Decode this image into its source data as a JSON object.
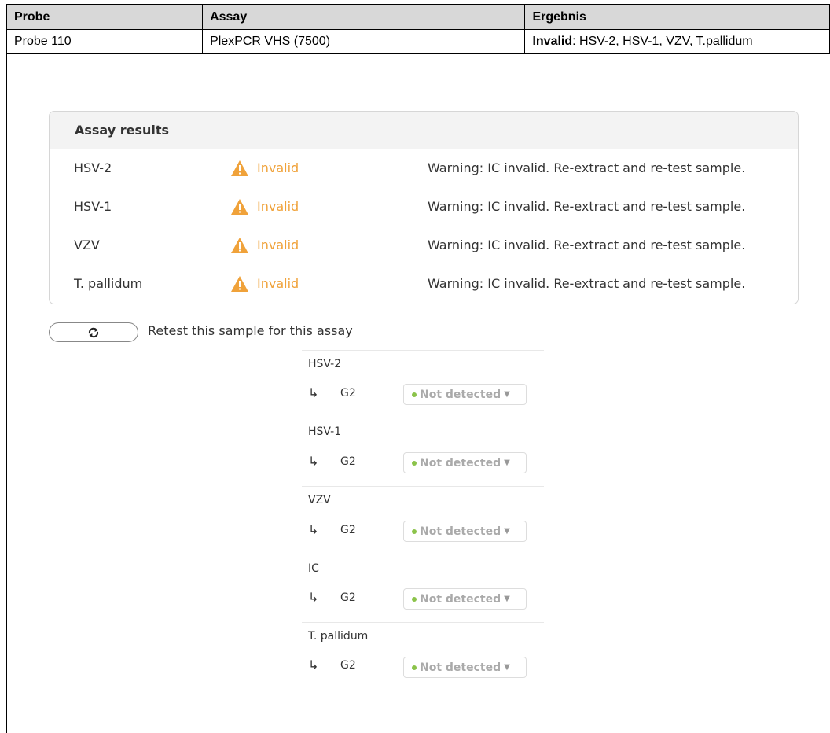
{
  "table": {
    "headers": [
      "Probe",
      "Assay",
      "Ergebnis"
    ],
    "row": {
      "probe": "Probe 110",
      "assay": "PlexPCR VHS (7500)",
      "result_bold": "Invalid",
      "result_rest": ": HSV-2, HSV-1, VZV, T.pallidum"
    }
  },
  "card": {
    "title": "Assay results",
    "rows": [
      {
        "name": "HSV-2",
        "status": "Invalid",
        "message": "Warning: IC invalid. Re-extract and re-test sample."
      },
      {
        "name": "HSV-1",
        "status": "Invalid",
        "message": "Warning: IC invalid. Re-extract and re-test sample."
      },
      {
        "name": "VZV",
        "status": "Invalid",
        "message": "Warning: IC invalid. Re-extract and re-test sample."
      },
      {
        "name": "T. pallidum",
        "status": "Invalid",
        "message": "Warning: IC invalid. Re-extract and re-test sample."
      }
    ]
  },
  "retest": {
    "label": "Retest this sample for this assay",
    "icon": "refresh-icon"
  },
  "overrides": [
    {
      "target": "HSV-2",
      "arrow": "↳",
      "channel": "G2",
      "value": "Not detected"
    },
    {
      "target": "HSV-1",
      "arrow": "↳",
      "channel": "G2",
      "value": "Not detected"
    },
    {
      "target": "VZV",
      "arrow": "↳",
      "channel": "G2",
      "value": "Not detected"
    },
    {
      "target": "IC",
      "arrow": "↳",
      "channel": "G2",
      "value": "Not detected"
    },
    {
      "target": "T. pallidum",
      "arrow": "↳",
      "channel": "G2",
      "value": "Not detected"
    }
  ],
  "colors": {
    "invalid": "#f0a23a",
    "not_detected_dot": "#8bc34a",
    "header_bg": "#d8d8d8"
  }
}
